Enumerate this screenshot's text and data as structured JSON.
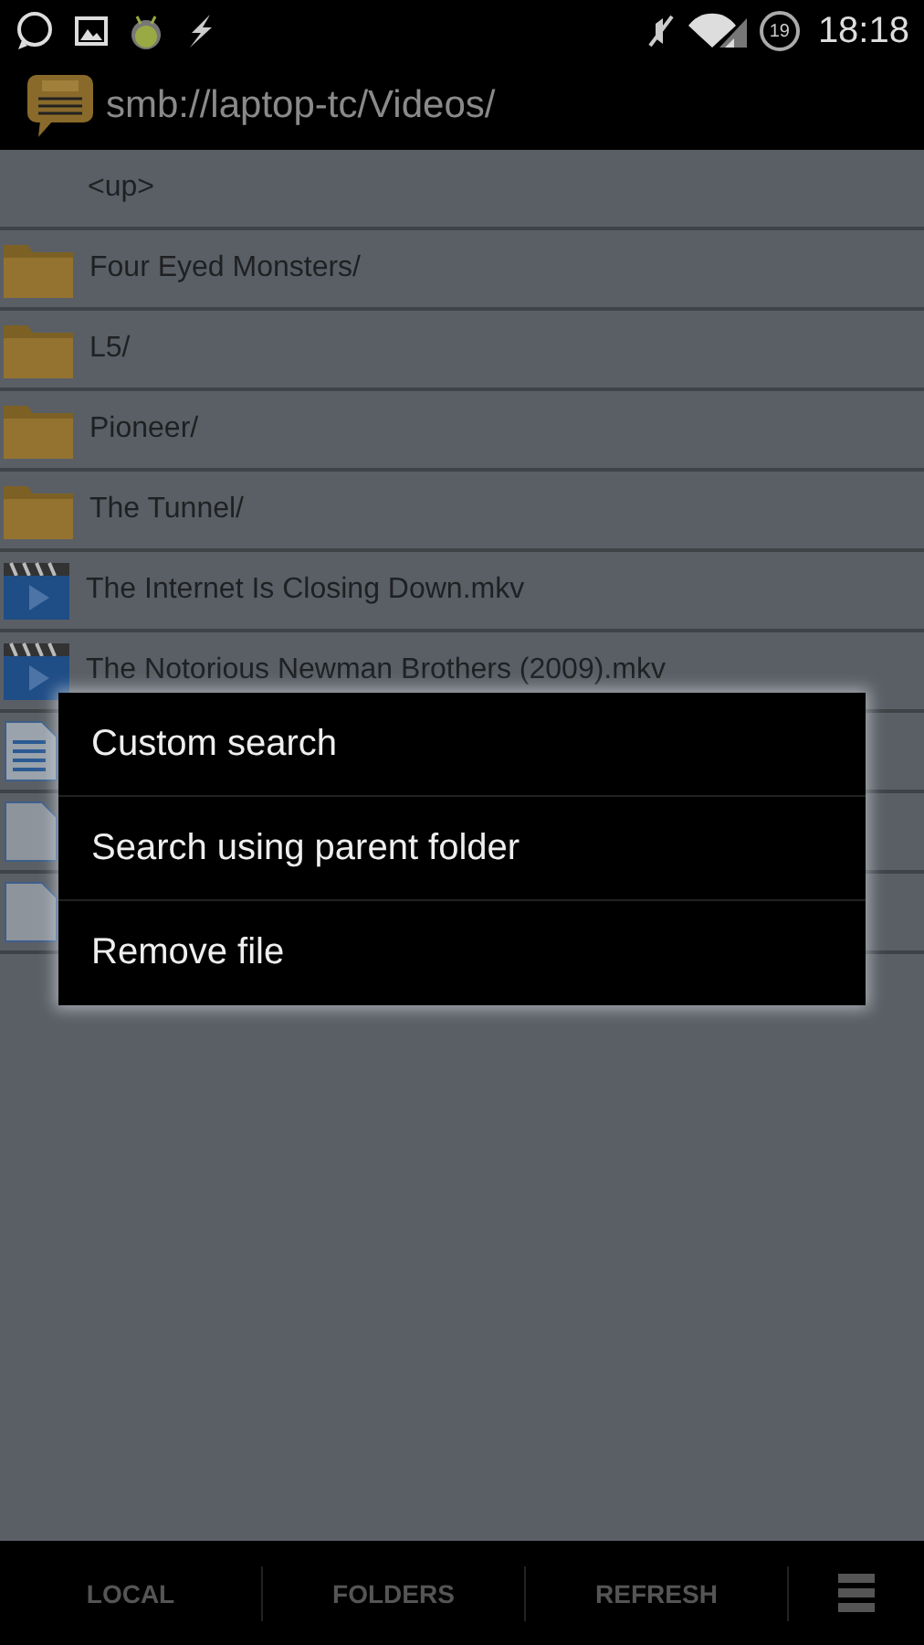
{
  "status_bar": {
    "time": "18:18",
    "battery": "19"
  },
  "title_bar": {
    "path": "smb://laptop-tc/Videos/"
  },
  "rows": [
    {
      "kind": "up",
      "name": "<up>"
    },
    {
      "kind": "folder",
      "name": "Four Eyed Monsters/"
    },
    {
      "kind": "folder",
      "name": "L5/"
    },
    {
      "kind": "folder",
      "name": "Pioneer/"
    },
    {
      "kind": "folder",
      "name": "The Tunnel/"
    },
    {
      "kind": "video",
      "name": "The Internet Is Closing Down.mkv"
    },
    {
      "kind": "video",
      "name": "The Notorious Newman Brothers (2009).mkv"
    },
    {
      "kind": "document"
    },
    {
      "kind": "file"
    },
    {
      "kind": "file"
    }
  ],
  "context_menu": {
    "items": [
      "Custom search",
      "Search using parent folder",
      "Remove file"
    ]
  },
  "bottom_bar": {
    "buttons": [
      "LOCAL",
      "FOLDERS",
      "REFRESH"
    ]
  }
}
